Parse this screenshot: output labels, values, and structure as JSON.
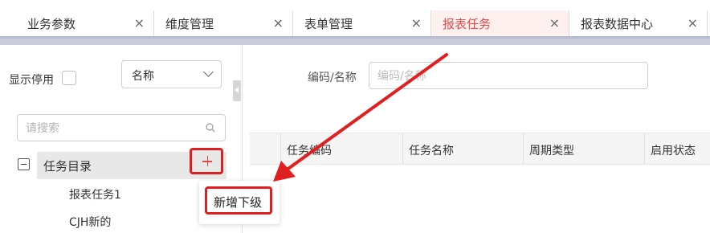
{
  "tabs": [
    {
      "label": "业务参数",
      "close": "×",
      "active": false
    },
    {
      "label": "维度管理",
      "close": "×",
      "active": false
    },
    {
      "label": "表单管理",
      "close": "×",
      "active": false
    },
    {
      "label": "报表任务",
      "close": "×",
      "active": true
    },
    {
      "label": "报表数据中心",
      "close": "×",
      "active": false
    }
  ],
  "left": {
    "show_disabled_label": "显示停用",
    "show_disabled_checked": false,
    "name_select": {
      "value": "名称",
      "icon": "chevron-down-icon"
    },
    "search": {
      "placeholder": "请搜索",
      "value": "",
      "icon": "search-icon"
    },
    "tree": {
      "root": {
        "label": "任务目录",
        "expanded": true,
        "add_icon": "plus-icon"
      },
      "children": [
        "报表任务1",
        "CJH新的"
      ]
    },
    "context_menu": {
      "items": [
        "新增下级"
      ]
    }
  },
  "right": {
    "filter": {
      "label": "编码/名称",
      "placeholder": "编码/名称",
      "value": ""
    },
    "table": {
      "columns": [
        "任务编码",
        "任务名称",
        "周期类型",
        "启用状态"
      ],
      "rows": []
    }
  },
  "colors": {
    "accent": "#e84a4a",
    "highlight_border": "#e02020",
    "tab_strip": "#c9ccdc",
    "tree_selected_bg": "#e8e8e8"
  }
}
